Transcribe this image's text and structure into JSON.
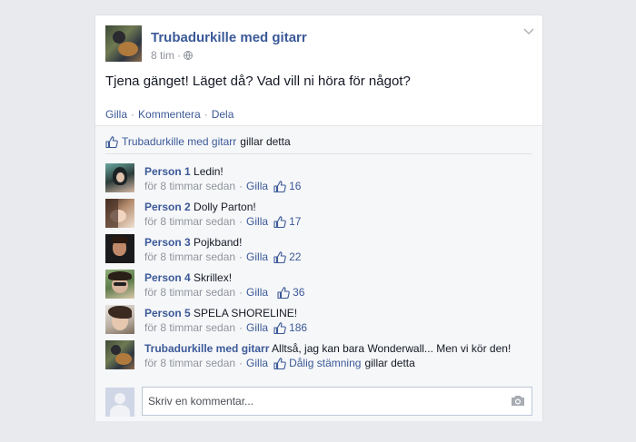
{
  "post": {
    "author": "Trubadurkille med gitarr",
    "time": "8 tim",
    "meta_sep": "·",
    "text": "Tjena gänget! Läget då? Vad vill ni höra för något?",
    "actions": [
      "Gilla",
      "Kommentera",
      "Dela"
    ],
    "action_sep": "·"
  },
  "likes": {
    "name": "Trubadurkille med gitarr",
    "suffix": "gillar detta"
  },
  "comments": [
    {
      "name": "Person 1",
      "text": "Ledin!",
      "time": "för 8 timmar sedan",
      "like_label": "Gilla",
      "count": "16",
      "sep": "·"
    },
    {
      "name": "Person 2",
      "text": "Dolly Parton!",
      "time": "för 8 timmar sedan",
      "like_label": "Gilla",
      "count": "17",
      "sep": "·"
    },
    {
      "name": "Person 3",
      "text": "Pojkband!",
      "time": "för 8 timmar sedan",
      "like_label": "Gilla",
      "count": "22",
      "sep": "·"
    },
    {
      "name": "Person 4",
      "text": "Skrillex!",
      "time": "för 8 timmar sedan",
      "like_label": "Gilla",
      "count": "36",
      "sep": "·"
    },
    {
      "name": "Person 5",
      "text": "SPELA SHORELINE!",
      "time": "för 8 timmar sedan",
      "like_label": "Gilla",
      "count": "186",
      "sep": "·"
    },
    {
      "name": "Trubadurkille med gitarr",
      "text": "Alltså, jag kan bara Wonderwall... Men vi kör den!",
      "time": "för 8 timmar sedan",
      "like_label": "Gilla",
      "liker": "Dålig stämning",
      "liker_suffix": "gillar detta",
      "sep": "·"
    }
  ],
  "compose": {
    "placeholder": "Skriv en kommentar..."
  },
  "colors": {
    "link": "#3b5998",
    "muted": "#90949c",
    "background": "#e9eaed"
  },
  "icons": [
    "chevron-down-icon",
    "globe-icon",
    "thumbs-up-icon",
    "camera-icon"
  ]
}
